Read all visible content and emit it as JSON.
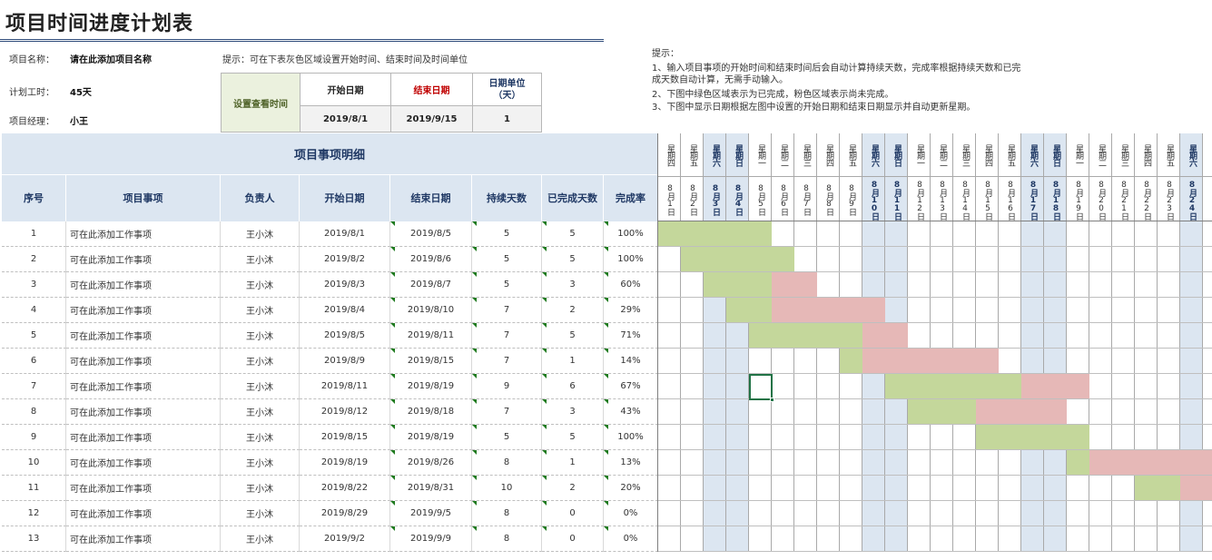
{
  "title": "项目时间进度计划表",
  "info": {
    "project_name_label": "项目名称：",
    "project_name_value": "请在此添加项目名称",
    "duration_label": "计划工时：",
    "duration_value": "45天",
    "manager_label": "项目经理：",
    "manager_value": "小王",
    "hint": "提示：可在下表灰色区域设置开始时间、结束时间及时间单位"
  },
  "settings": {
    "label": "设置查看时间",
    "start_header": "开始日期",
    "end_header": "结束日期",
    "unit_header": "日期单位（天）",
    "start_value": "2019/8/1",
    "end_value": "2019/9/15",
    "unit_value": "1"
  },
  "tips": [
    "提示：",
    "1、输入项目事项的开始时间和结束时间后会自动计算持续天数，完成率根据持续天数和已完",
    "成天数自动计算，无需手动输入。",
    "2、下图中绿色区域表示为已完成，粉色区域表示尚未完成。",
    "3、下图中显示日期根据左图中设置的开始日期和结束日期显示并自动更新星期。"
  ],
  "table": {
    "section_title": "项目事项明细",
    "columns": [
      "序号",
      "项目事项",
      "负责人",
      "开始日期",
      "结束日期",
      "持续天数",
      "已完成天数",
      "完成率"
    ],
    "rows": [
      [
        "1",
        "可在此添加工作事项",
        "王小沐",
        "2019/8/1",
        "2019/8/5",
        "5",
        "5",
        "100%"
      ],
      [
        "2",
        "可在此添加工作事项",
        "王小沐",
        "2019/8/2",
        "2019/8/6",
        "5",
        "5",
        "100%"
      ],
      [
        "3",
        "可在此添加工作事项",
        "王小沐",
        "2019/8/3",
        "2019/8/7",
        "5",
        "3",
        "60%"
      ],
      [
        "4",
        "可在此添加工作事项",
        "王小沐",
        "2019/8/4",
        "2019/8/10",
        "7",
        "2",
        "29%"
      ],
      [
        "5",
        "可在此添加工作事项",
        "王小沐",
        "2019/8/5",
        "2019/8/11",
        "7",
        "5",
        "71%"
      ],
      [
        "6",
        "可在此添加工作事项",
        "王小沐",
        "2019/8/9",
        "2019/8/15",
        "7",
        "1",
        "14%"
      ],
      [
        "7",
        "可在此添加工作事项",
        "王小沐",
        "2019/8/11",
        "2019/8/19",
        "9",
        "6",
        "67%"
      ],
      [
        "8",
        "可在此添加工作事项",
        "王小沐",
        "2019/8/12",
        "2019/8/18",
        "7",
        "3",
        "43%"
      ],
      [
        "9",
        "可在此添加工作事项",
        "王小沐",
        "2019/8/15",
        "2019/8/19",
        "5",
        "5",
        "100%"
      ],
      [
        "10",
        "可在此添加工作事项",
        "王小沐",
        "2019/8/19",
        "2019/8/26",
        "8",
        "1",
        "13%"
      ],
      [
        "11",
        "可在此添加工作事项",
        "王小沐",
        "2019/8/22",
        "2019/8/31",
        "10",
        "2",
        "20%"
      ],
      [
        "12",
        "可在此添加工作事项",
        "王小沐",
        "2019/8/29",
        "2019/9/5",
        "8",
        "0",
        "0%"
      ],
      [
        "13",
        "可在此添加工作事项",
        "王小沐",
        "2019/9/2",
        "2019/9/9",
        "8",
        "0",
        "0%"
      ]
    ]
  },
  "gantt": {
    "days": [
      {
        "date": "8月1日",
        "weekday": "星期四",
        "weekend": false
      },
      {
        "date": "8月2日",
        "weekday": "星期五",
        "weekend": false
      },
      {
        "date": "8月3日",
        "weekday": "星期六",
        "weekend": true
      },
      {
        "date": "8月4日",
        "weekday": "星期日",
        "weekend": true
      },
      {
        "date": "8月5日",
        "weekday": "星期一",
        "weekend": false
      },
      {
        "date": "8月6日",
        "weekday": "星期二",
        "weekend": false
      },
      {
        "date": "8月7日",
        "weekday": "星期三",
        "weekend": false
      },
      {
        "date": "8月8日",
        "weekday": "星期四",
        "weekend": false
      },
      {
        "date": "8月9日",
        "weekday": "星期五",
        "weekend": false
      },
      {
        "date": "8月10日",
        "weekday": "星期六",
        "weekend": true
      },
      {
        "date": "8月11日",
        "weekday": "星期日",
        "weekend": true
      },
      {
        "date": "8月12日",
        "weekday": "星期一",
        "weekend": false
      },
      {
        "date": "8月13日",
        "weekday": "星期二",
        "weekend": false
      },
      {
        "date": "8月14日",
        "weekday": "星期三",
        "weekend": false
      },
      {
        "date": "8月15日",
        "weekday": "星期四",
        "weekend": false
      },
      {
        "date": "8月16日",
        "weekday": "星期五",
        "weekend": false
      },
      {
        "date": "8月17日",
        "weekday": "星期六",
        "weekend": true
      },
      {
        "date": "8月18日",
        "weekday": "星期日",
        "weekend": true
      },
      {
        "date": "8月19日",
        "weekday": "星期一",
        "weekend": false
      },
      {
        "date": "8月20日",
        "weekday": "星期二",
        "weekend": false
      },
      {
        "date": "8月21日",
        "weekday": "星期三",
        "weekend": false
      },
      {
        "date": "8月22日",
        "weekday": "星期四",
        "weekend": false
      },
      {
        "date": "8月23日",
        "weekday": "星期五",
        "weekend": false
      },
      {
        "date": "8月24日",
        "weekday": "星期六",
        "weekend": true
      }
    ],
    "colors": {
      "done": "#c4d79b",
      "remaining": "#e6b8b7",
      "weekend": "#dce6f1",
      "header": "#dce6f1",
      "settings_label_bg": "#ebf1de",
      "settings_value_bg": "#f2f2f2",
      "end_header_text": "#c00000",
      "unit_header_text": "#1f3864",
      "weekend_text": "#1f3864"
    },
    "selected_day": "8月5日",
    "selected_task": "7"
  }
}
